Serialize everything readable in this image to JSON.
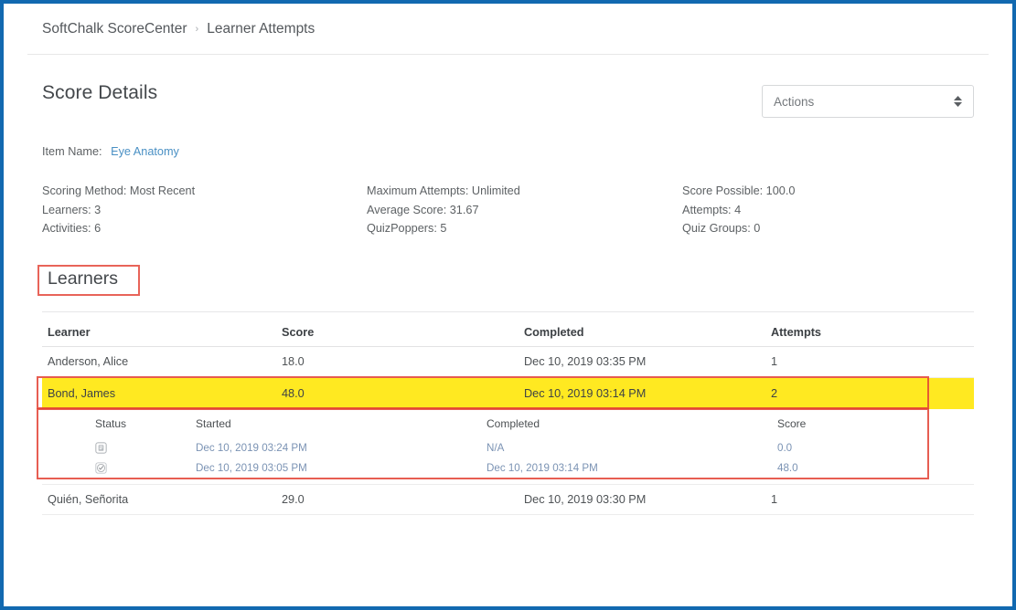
{
  "breadcrumb": {
    "root": "SoftChalk ScoreCenter",
    "separator": "›",
    "current": "Learner Attempts"
  },
  "score_details": {
    "title": "Score Details",
    "actions_select": {
      "value": "Actions",
      "icon": "updown-chevron-icon"
    },
    "item_name_label": "Item Name:",
    "item_name_value": "Eye Anatomy",
    "stats_columns": [
      [
        "Scoring Method: Most Recent",
        "Learners: 3",
        "Activities:  6"
      ],
      [
        "Maximum Attempts: Unlimited",
        "Average Score: 31.67",
        "QuizPoppers:  5"
      ],
      [
        "Score Possible: 100.0",
        "Attempts: 4",
        "Quiz Groups:  0"
      ]
    ]
  },
  "learners_section": {
    "title": "Learners",
    "headers": {
      "learner": "Learner",
      "score": "Score",
      "completed": "Completed",
      "attempts": "Attempts"
    },
    "rows": [
      {
        "learner": "Anderson, Alice",
        "score": "18.0",
        "completed": "Dec 10, 2019 03:35 PM",
        "attempts": "1",
        "highlighted": false
      },
      {
        "learner": "Bond, James",
        "score": "48.0",
        "completed": "Dec 10, 2019 03:14 PM",
        "attempts": "2",
        "highlighted": true
      },
      {
        "learner": "Quién, Señorita",
        "score": "29.0",
        "completed": "Dec 10, 2019 03:30 PM",
        "attempts": "1",
        "highlighted": false
      }
    ],
    "attempt_detail": {
      "headers": {
        "status": "Status",
        "started": "Started",
        "completed": "Completed",
        "score": "Score"
      },
      "rows": [
        {
          "status_icon": "in-progress-document-icon",
          "started": "Dec 10, 2019 03:24 PM",
          "completed": "N/A",
          "score": "0.0"
        },
        {
          "status_icon": "completed-check-circle-icon",
          "started": "Dec 10, 2019 03:05 PM",
          "completed": "Dec 10, 2019 03:14 PM",
          "score": "48.0"
        }
      ]
    }
  },
  "colors": {
    "frame_border": "#1269b0",
    "annotation_red": "#e34234",
    "highlight_yellow": "#ffe921",
    "link_blue": "#4a90c4"
  }
}
